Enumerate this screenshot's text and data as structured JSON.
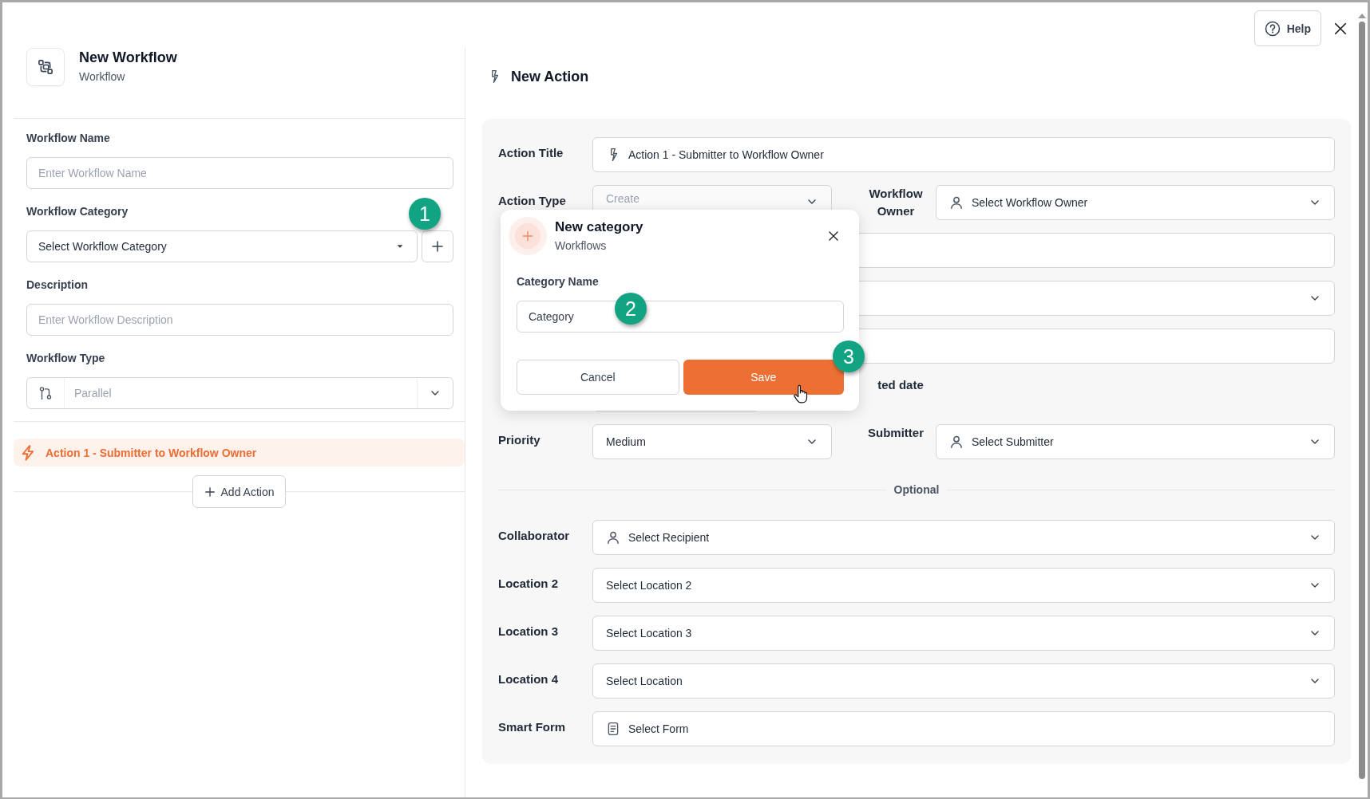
{
  "header": {
    "title": "New Workflow",
    "subtitle": "Workflow"
  },
  "workflow_fields": [
    {
      "label": "Workflow Name",
      "kind": "input",
      "placeholder": "Enter Workflow Name"
    },
    {
      "label": "Workflow Category",
      "kind": "select-add",
      "value": "Select Workflow Category"
    },
    {
      "label": "Description",
      "kind": "input",
      "placeholder": "Enter Workflow Description"
    },
    {
      "label": "Workflow Type",
      "kind": "branch-select",
      "value": "Parallel"
    }
  ],
  "actions": [
    {
      "title": "Action 1 - Submitter to Workflow Owner",
      "selected": true
    }
  ],
  "add_action_button": "Add Action",
  "help_button": "Help",
  "action_form": {
    "title": "New Action",
    "rows": [
      {
        "kind": "fields",
        "cells": [
          {
            "label": "Action Title",
            "field": {
              "kind": "bolt-input",
              "value": "Action 1 - Submitter to Workflow Owner"
            }
          }
        ]
      },
      {
        "kind": "fields",
        "cells": [
          {
            "label": "Action Type",
            "field": {
              "kind": "select",
              "value": "Create",
              "disabled": true
            }
          },
          {
            "label": "Workflow Owner",
            "field": {
              "kind": "person-select",
              "value": "Select Workflow Owner"
            }
          }
        ]
      },
      {
        "kind": "fields",
        "cells": [
          {
            "field": {
              "kind": "blank-input"
            }
          }
        ]
      },
      {
        "kind": "fields",
        "cells": [
          {
            "field": {
              "kind": "blank-select"
            }
          }
        ]
      },
      {
        "kind": "fields",
        "cells": [
          {
            "field": {
              "kind": "blank-input"
            }
          }
        ]
      },
      {
        "kind": "fields",
        "cells": [
          {
            "field": {
              "kind": "blank-short"
            }
          },
          {
            "label": "ted date"
          }
        ]
      },
      {
        "kind": "fields",
        "cells": [
          {
            "label": "Priority",
            "field": {
              "kind": "select",
              "value": "Medium",
              "disabled": false
            }
          },
          {
            "label": "Submitter",
            "field": {
              "kind": "person-select",
              "value": "Select Submitter"
            }
          }
        ]
      },
      {
        "kind": "divider",
        "label": "Optional"
      },
      {
        "kind": "fields",
        "cells": [
          {
            "label": "Collaborator",
            "field": {
              "kind": "person-select",
              "value": "Select Recipient"
            }
          }
        ]
      },
      {
        "kind": "fields",
        "cells": [
          {
            "label": "Location 2",
            "field": {
              "kind": "select",
              "value": "Select Location 2",
              "disabled": false
            }
          }
        ]
      },
      {
        "kind": "fields",
        "cells": [
          {
            "label": "Location 3",
            "field": {
              "kind": "select",
              "value": "Select Location 3",
              "disabled": false
            }
          }
        ]
      },
      {
        "kind": "fields",
        "cells": [
          {
            "label": "Location 4",
            "field": {
              "kind": "select",
              "value": "Select Location",
              "disabled": false
            }
          }
        ]
      },
      {
        "kind": "fields",
        "cells": [
          {
            "label": "Smart Form",
            "field": {
              "kind": "form-select",
              "value": "Select Form"
            }
          }
        ]
      }
    ]
  },
  "dialog": {
    "title": "New category",
    "subtitle": "Workflows",
    "field_label": "Category Name",
    "value": "Category",
    "cancel_button": "Cancel",
    "save_button": "Save"
  },
  "step_badges": [
    "1",
    "2",
    "3"
  ]
}
